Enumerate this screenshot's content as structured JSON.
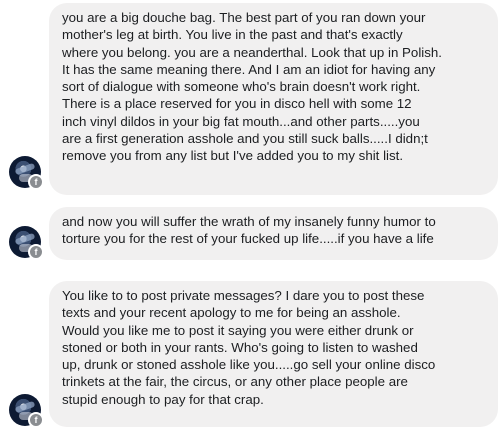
{
  "messages": [
    {
      "avatar_icon": "profile-photo",
      "badge_icon": "facebook-f-icon",
      "text": "you are a big douche bag. The best part of you ran down your\nmother's leg at birth. You live in the past and that's exactly\nwhere you belong. you are a neanderthal. Look that up in Polish.\nIt has the same meaning there. And I am an idiot for having any\nsort of dialogue with someone who's brain doesn't work right.\nThere is a place reserved for you in disco hell with some 12\ninch vinyl dildos in your big fat mouth...and other parts.....you\nare a first generation asshole and you still suck balls.....I didn;t\nremove you from any list but I've added you to my shit list."
    },
    {
      "avatar_icon": "profile-photo",
      "badge_icon": "facebook-f-icon",
      "text": "and now you will suffer the wrath of my insanely funny humor to\ntorture you for the rest of your fucked up life.....if you have a life"
    },
    {
      "avatar_icon": "profile-photo",
      "badge_icon": "facebook-f-icon",
      "text": "You like to to post private messages? I dare you to post these\ntexts and your recent apology to me for being an asshole.\nWould you like me to post it saying you were either drunk or\nstoned or both in your rants. Who's going to listen to washed\nup,  drunk or stoned asshole like you.....go sell your online disco\ntrinkets at the fair, the circus,  or any other place people are\nstupid enough to pay for that crap."
    }
  ],
  "badge_glyph": "f"
}
